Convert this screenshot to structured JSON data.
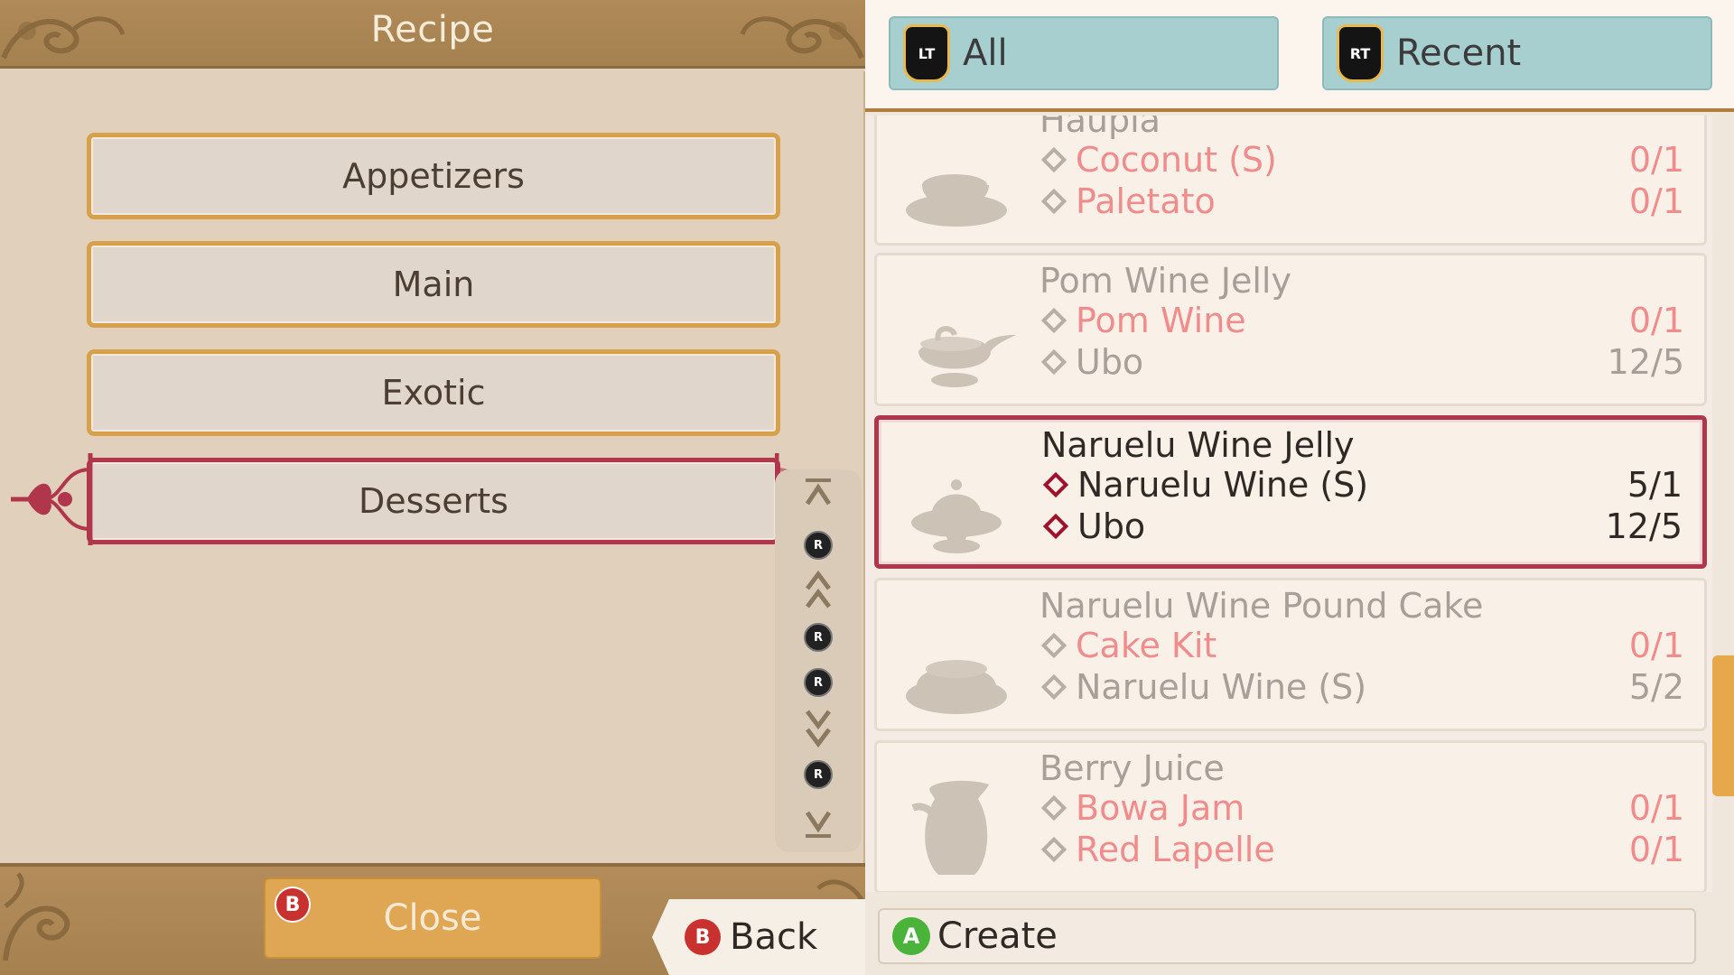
{
  "header": {
    "title": "Recipe"
  },
  "categories": [
    {
      "label": "Appetizers"
    },
    {
      "label": "Main"
    },
    {
      "label": "Exotic"
    },
    {
      "label": "Desserts"
    }
  ],
  "selected_category": "Desserts",
  "nav_strip": {
    "r_label": "R"
  },
  "close_button": {
    "badge": "B",
    "label": "Close"
  },
  "back_button": {
    "badge": "B",
    "label": "Back"
  },
  "tabs": [
    {
      "badge": "LT",
      "label": "All"
    },
    {
      "badge": "RT",
      "label": "Recent"
    }
  ],
  "recipes": [
    {
      "name": "Haupia",
      "icon": "bowl-dish-icon",
      "ingredients": [
        {
          "name": "Coconut (S)",
          "qty": "0/1",
          "status": "missing"
        },
        {
          "name": "Paletato",
          "qty": "0/1",
          "status": "missing"
        }
      ]
    },
    {
      "name": "Pom Wine Jelly",
      "icon": "gravy-boat-icon",
      "ingredients": [
        {
          "name": "Pom Wine",
          "qty": "0/1",
          "status": "missing"
        },
        {
          "name": "Ubo",
          "qty": "12/5",
          "status": "have"
        }
      ]
    },
    {
      "name": "Naruelu Wine Jelly",
      "icon": "jelly-dish-icon",
      "selected": true,
      "ingredients": [
        {
          "name": "Naruelu Wine (S)",
          "qty": "5/1",
          "status": "have"
        },
        {
          "name": "Ubo",
          "qty": "12/5",
          "status": "have"
        }
      ]
    },
    {
      "name": "Naruelu Wine Pound Cake",
      "icon": "cake-icon",
      "ingredients": [
        {
          "name": "Cake Kit",
          "qty": "0/1",
          "status": "missing"
        },
        {
          "name": "Naruelu Wine (S)",
          "qty": "5/2",
          "status": "have"
        }
      ]
    },
    {
      "name": "Berry Juice",
      "icon": "pitcher-icon",
      "ingredients": [
        {
          "name": "Bowa Jam",
          "qty": "0/1",
          "status": "missing"
        },
        {
          "name": "Red Lapelle",
          "qty": "0/1",
          "status": "missing"
        }
      ]
    }
  ],
  "create_button": {
    "badge": "A",
    "label": "Create"
  },
  "colors": {
    "accent_gold": "#d7a14b",
    "selection_red": "#b0364c",
    "tab_blue": "#a7cfd0",
    "missing_pink": "#f08c8c"
  }
}
